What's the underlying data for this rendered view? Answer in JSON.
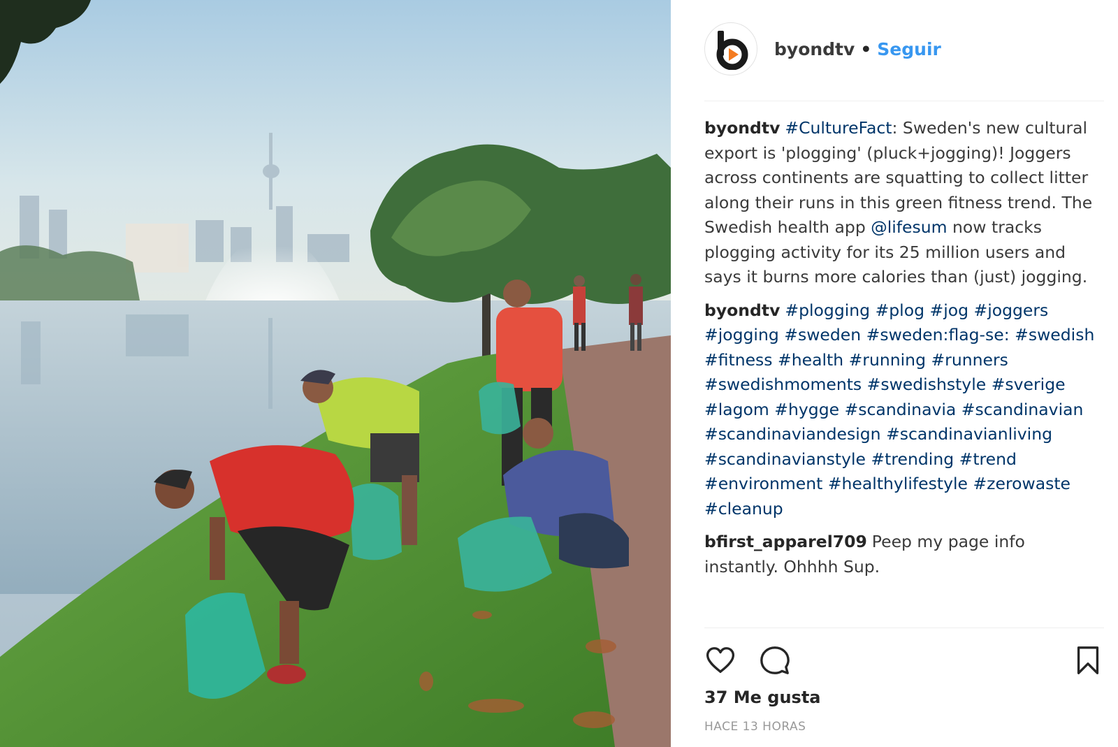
{
  "photo": {
    "alt_icon": "photo-image",
    "colors": {
      "sky": "#c9dee9",
      "water": "#b3c6d2",
      "grass": "#5d9a3b",
      "path": "#9a7468"
    }
  },
  "post": {
    "author": {
      "username": "byondtv",
      "separator": "•",
      "follow_label": "Seguir",
      "avatar_icon": "byondtv-logo"
    },
    "caption": {
      "username": "byondtv",
      "parts": [
        {
          "type": "tag",
          "text": "#CultureFact"
        },
        {
          "type": "text",
          "text": ": Sweden's new cultural export is 'plogging' (pluck+jogging)! Joggers across continents are squatting to collect litter along their runs in this green fitness trend. The Swedish health app "
        },
        {
          "type": "mention",
          "text": "@lifesum"
        },
        {
          "type": "text",
          "text": " now tracks plogging activity for its 25 million users and says it burns more calories than (just) jogging."
        }
      ]
    },
    "hashtag_comment": {
      "username": "byondtv",
      "tags": [
        "#plogging",
        "#plog",
        "#jog",
        "#joggers",
        "#jogging",
        "#sweden",
        "#sweden:flag-se:",
        "#swedish",
        "#fitness",
        "#health",
        "#running",
        "#runners",
        "#swedishmoments",
        "#swedishstyle",
        "#sverige",
        "#lagom",
        "#hygge",
        "#scandinavia",
        "#scandinavian",
        "#scandinaviandesign",
        "#scandinavianliving",
        "#scandinavianstyle",
        "#trending",
        "#trend",
        "#environment",
        "#healthylifestyle",
        "#zerowaste",
        "#cleanup"
      ]
    },
    "other_comment": {
      "username": "bfirst_apparel709",
      "text": "Peep my page info instantly. Ohhhh Sup."
    },
    "actions": {
      "like_icon": "heart-icon",
      "comment_icon": "comment-bubble-icon",
      "save_icon": "bookmark-icon"
    },
    "likes_text": "37 Me gusta",
    "timestamp": "HACE 13 HORAS"
  }
}
